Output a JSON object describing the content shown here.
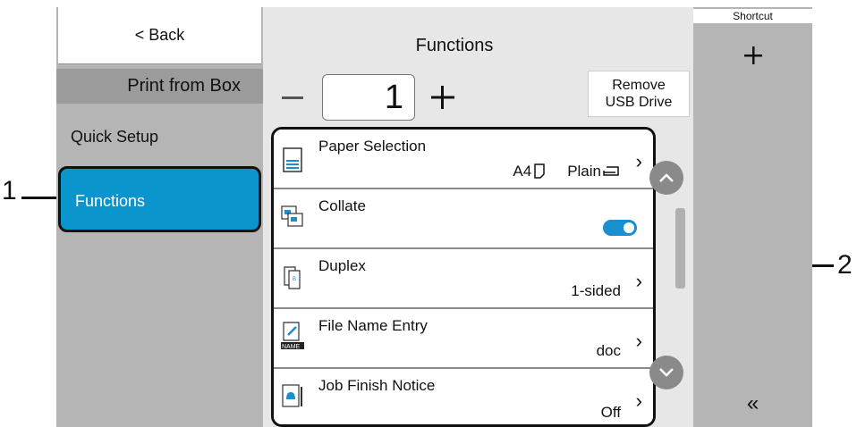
{
  "left_panel": {
    "back_label": "< Back",
    "box_title": "Print from Box",
    "nav_items": [
      {
        "label": "Quick Setup"
      },
      {
        "label": "Functions"
      }
    ]
  },
  "center": {
    "title": "Functions",
    "copies": "1",
    "remove_usb_line1": "Remove",
    "remove_usb_line2": "USB Drive"
  },
  "functions": [
    {
      "label": "Paper Selection",
      "value_size": "A4",
      "value_type": "Plain"
    },
    {
      "label": "Collate",
      "toggle_on": true
    },
    {
      "label": "Duplex",
      "value": "1-sided"
    },
    {
      "label": "File Name Entry",
      "value": "doc",
      "icon_text": "NAME"
    },
    {
      "label": "Job Finish Notice",
      "value": "Off"
    }
  ],
  "right_panel": {
    "shortcut_label": "Shortcut",
    "collapse_glyph": "«"
  },
  "callouts": {
    "one": "1",
    "two": "2"
  },
  "colors": {
    "selected_nav": "#0b95cd",
    "toggle": "#1a8fcf",
    "panel_gray": "#b5b5b5"
  }
}
